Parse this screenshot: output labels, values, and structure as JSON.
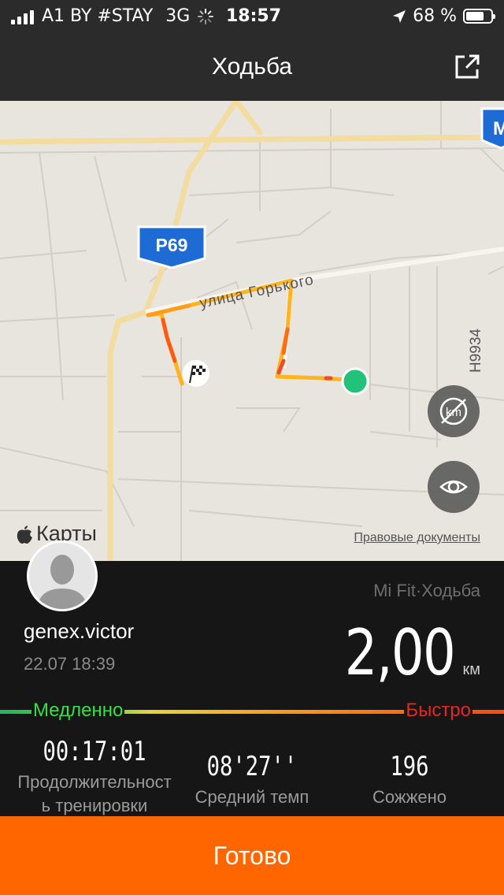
{
  "status_bar": {
    "carrier": "A1 BY #STAY",
    "network": "3G",
    "time": "18:57",
    "battery": "68 %"
  },
  "nav": {
    "title": "Ходьба"
  },
  "map": {
    "road_badge_p69": "P69",
    "road_badge_m": "M",
    "road_h9934": "H9934",
    "street_name": "улица Горького",
    "attribution": "Карты",
    "legal": "Правовые документы"
  },
  "workout": {
    "username": "genex.victor",
    "date": "22.07 18:39",
    "source": "Mi Fit·Ходьба",
    "distance_value": "2,00",
    "distance_unit": "км",
    "slow_label": "Медленно",
    "fast_label": "Быстро",
    "stats": [
      {
        "value": "00:17:01",
        "label": "Продолжительность тренировки"
      },
      {
        "value": "08'27''",
        "label": "Средний темп"
      },
      {
        "value": "196",
        "label": "Сожжено"
      }
    ]
  },
  "done_label": "Готово",
  "colors": {
    "accent": "#ff6600",
    "route": "#ffb41e",
    "slow": "#36e043",
    "fast": "#e82525",
    "end_point": "#22c27a"
  }
}
